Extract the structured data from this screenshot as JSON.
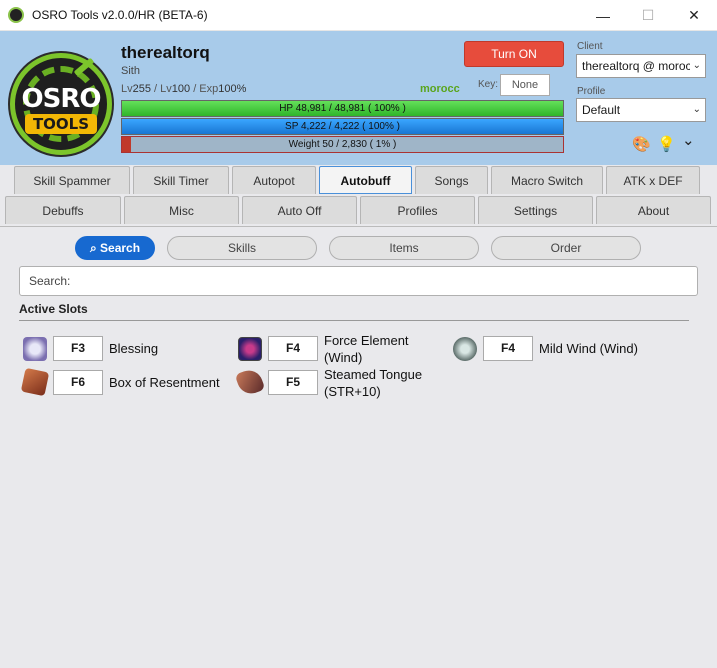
{
  "window": {
    "title": "OSRO Tools v2.0.0/HR (BETA-6)",
    "minimize": "—",
    "maximize": "☐",
    "close": "✕"
  },
  "logo": {
    "top": "OSRO",
    "bottom": "TOOLS"
  },
  "character": {
    "name": "therealtorq",
    "class": "Sith",
    "level_prefix": "Lv",
    "base_level": "255",
    "job_level": "100",
    "exp": "100%",
    "server": "morocc"
  },
  "bars": {
    "hp_text": "HP  48,981  /  48,981  ( 100% )",
    "sp_text": "SP  4,222  /  4,222  ( 100% )",
    "weight_text": "Weight  50  /  2,830  ( 1% )",
    "weight_fraction": 0.02
  },
  "controls": {
    "turn_on": "Turn ON",
    "key_label": "Key:",
    "key_value": "None",
    "client_label": "Client",
    "client_value": "therealtorq @ moroc",
    "profile_label": "Profile",
    "profile_value": "Default",
    "caret": "⌄"
  },
  "icons": {
    "palette": "🎨",
    "bulb": "💡",
    "chevron": "⌄"
  },
  "tabs_row1": [
    "Skill Spammer",
    "Skill Timer",
    "Autopot",
    "Autobuff",
    "Songs",
    "Macro Switch",
    "ATK x DEF"
  ],
  "tabs_row2": [
    "Debuffs",
    "Misc",
    "Auto Off",
    "Profiles",
    "Settings",
    "About"
  ],
  "active_tab": "Autobuff",
  "filters": [
    "Search",
    "Skills",
    "Items",
    "Order"
  ],
  "search": {
    "placeholder": "Search:"
  },
  "section": {
    "title": "Active Slots"
  },
  "slots": [
    {
      "key": "F3",
      "name": "Blessing"
    },
    {
      "key": "F4",
      "name": "Force Element",
      "name2": "(Wind)"
    },
    {
      "key": "F4",
      "name": "Mild Wind (Wind)"
    },
    {
      "key": "F6",
      "name": "Box of Resentment"
    },
    {
      "key": "F5",
      "name": "Steamed Tongue",
      "name2": "(STR+10)"
    }
  ],
  "colors": {
    "accent": "#1769d0",
    "turn_on": "#e74c3c",
    "header": "#a8cbea",
    "hp": "#3cc234",
    "sp": "#1e88e5"
  }
}
